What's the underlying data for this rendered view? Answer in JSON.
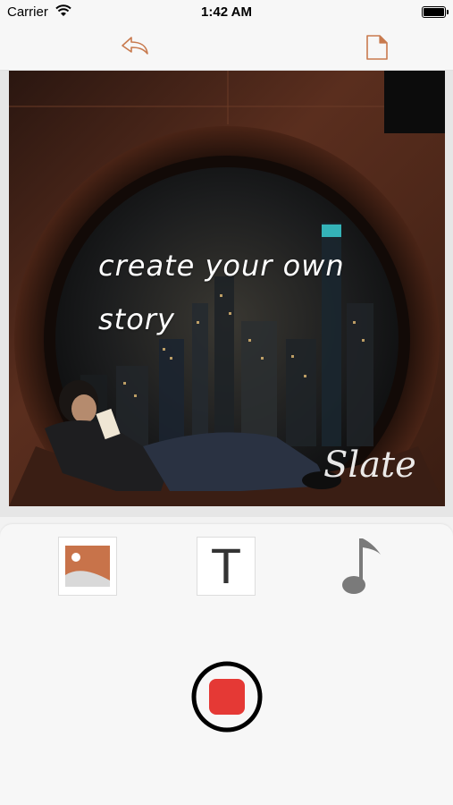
{
  "status_bar": {
    "carrier": "Carrier",
    "time": "1:42 AM"
  },
  "canvas": {
    "caption_line1": "create your own",
    "caption_line2": "story",
    "watermark": "Slate"
  },
  "tools": {
    "image_tool_icon": "image-icon",
    "text_tool_label": "T",
    "music_tool_icon": "music-note-icon"
  },
  "colors": {
    "accent": "#c87a4e",
    "record": "#e53935"
  }
}
